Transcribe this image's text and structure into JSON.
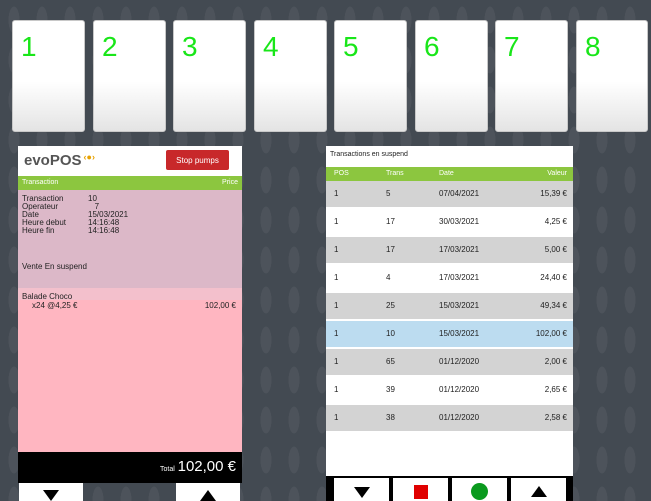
{
  "pumps": [
    "1",
    "2",
    "3",
    "4",
    "5",
    "6",
    "7",
    "8"
  ],
  "left_panel": {
    "logo_text": "evoPOS",
    "logo_mark": "‹●›",
    "stop_pumps_label": "Stop pumps",
    "col_transaction": "Transaction",
    "col_price": "Price",
    "info": [
      {
        "label": "Transaction",
        "value": "10"
      },
      {
        "label": "Operateur",
        "value": "   7"
      },
      {
        "label": "Date",
        "value": "15/03/2021"
      },
      {
        "label": "Heure debut",
        "value": "14:16:48"
      },
      {
        "label": "Heure fin",
        "value": "14:16:48"
      }
    ],
    "status_text": "Vente En suspend",
    "item_name": "Balade Choco",
    "item_qty": "x24 @4,25 €",
    "item_price": "102,00 €",
    "total_label": "Total",
    "total_value": "102,00 €"
  },
  "right_panel": {
    "title": "Transactions en suspend",
    "columns": {
      "pos": "POS",
      "trans": "Trans",
      "date": "Date",
      "value": "Valeur"
    },
    "rows": [
      {
        "pos": "1",
        "trans": "5",
        "date": "07/04/2021",
        "value": "15,39 €"
      },
      {
        "pos": "1",
        "trans": "17",
        "date": "30/03/2021",
        "value": "4,25 €"
      },
      {
        "pos": "1",
        "trans": "17",
        "date": "17/03/2021",
        "value": "5,00 €"
      },
      {
        "pos": "1",
        "trans": "4",
        "date": "17/03/2021",
        "value": "24,40 €"
      },
      {
        "pos": "1",
        "trans": "25",
        "date": "15/03/2021",
        "value": "49,34 €"
      },
      {
        "pos": "1",
        "trans": "10",
        "date": "15/03/2021",
        "value": "102,00 €"
      },
      {
        "pos": "1",
        "trans": "65",
        "date": "01/12/2020",
        "value": "2,00 €"
      },
      {
        "pos": "1",
        "trans": "39",
        "date": "01/12/2020",
        "value": "2,65 €"
      },
      {
        "pos": "1",
        "trans": "38",
        "date": "01/12/2020",
        "value": "2,58 €"
      }
    ],
    "selected_row": 5
  },
  "icons": {
    "pump_digit_color": "#19e619",
    "accent_green": "#8cc63f",
    "stop_red": "#c8282a",
    "selected_row_color": "#bcdcf0"
  }
}
